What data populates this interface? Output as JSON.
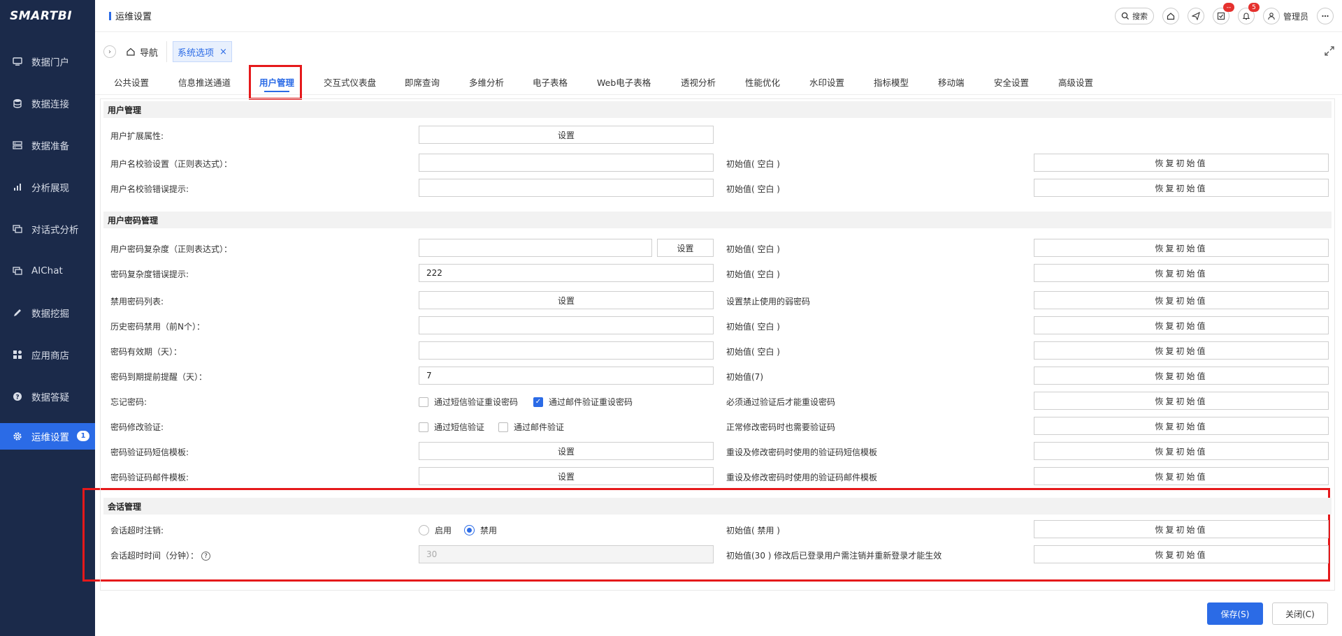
{
  "app": {
    "logo": "SMARTBI"
  },
  "sidebar": {
    "items": [
      {
        "label": "数据门户",
        "icon": "monitor-icon"
      },
      {
        "label": "数据连接",
        "icon": "database-icon"
      },
      {
        "label": "数据准备",
        "icon": "server-icon"
      },
      {
        "label": "分析展现",
        "icon": "bar-chart-icon"
      },
      {
        "label": "对话式分析",
        "icon": "chat-icon"
      },
      {
        "label": "AIChat",
        "icon": "chat-icon"
      },
      {
        "label": "数据挖掘",
        "icon": "pen-icon"
      },
      {
        "label": "应用商店",
        "icon": "apps-icon"
      },
      {
        "label": "数据答疑",
        "icon": "question-icon"
      },
      {
        "label": "运维设置",
        "icon": "gear-icon",
        "badge": "1"
      }
    ]
  },
  "header": {
    "title": "运维设置",
    "search_label": "搜索",
    "task_badge": "--",
    "notice_badge": "5",
    "user": "管理员"
  },
  "breadcrumb": {
    "home": "导航",
    "tab": "系统选项"
  },
  "tabs": [
    "公共设置",
    "信息推送通道",
    "用户管理",
    "交互式仪表盘",
    "即席查询",
    "多维分析",
    "电子表格",
    "Web电子表格",
    "透视分析",
    "性能优化",
    "水印设置",
    "指标模型",
    "移动端",
    "安全设置",
    "高级设置"
  ],
  "active_tab": "用户管理",
  "sections": {
    "user_mgmt": "用户管理",
    "pwd_mgmt": "用户密码管理",
    "session_mgmt": "会话管理"
  },
  "common": {
    "set": "设置",
    "restore": "恢复初始值",
    "init_blank": "初始值( 空白 )"
  },
  "rows": {
    "ext_attr": {
      "label": "用户扩展属性:"
    },
    "name_check": {
      "label": "用户名校验设置（正则表达式）：",
      "value": ""
    },
    "name_err": {
      "label": "用户名校验错误提示:",
      "value": ""
    },
    "pwd_complex": {
      "label": "用户密码复杂度（正则表达式）：",
      "value": ""
    },
    "pwd_complex_err": {
      "label": "密码复杂度错误提示:",
      "value": "222"
    },
    "banned_list": {
      "label": "禁用密码列表:",
      "hint": "设置禁止使用的弱密码"
    },
    "history": {
      "label": "历史密码禁用（前N个）：",
      "value": ""
    },
    "validity": {
      "label": "密码有效期（天）：",
      "value": ""
    },
    "remind": {
      "label": "密码到期提前提醒（天）：",
      "value": "7",
      "hint": "初始值(7)"
    },
    "forgot": {
      "label": "忘记密码:",
      "opt1": "通过短信验证重设密码",
      "opt2": "通过邮件验证重设密码",
      "hint": "必须通过验证后才能重设密码"
    },
    "modify_verify": {
      "label": "密码修改验证:",
      "opt1": "通过短信验证",
      "opt2": "通过邮件验证",
      "hint": "正常修改密码时也需要验证码"
    },
    "sms_tpl": {
      "label": "密码验证码短信模板:",
      "hint": "重设及修改密码时使用的验证码短信模板"
    },
    "mail_tpl": {
      "label": "密码验证码邮件模板:",
      "hint": "重设及修改密码时使用的验证码邮件模板"
    },
    "session_logout": {
      "label": "会话超时注销:",
      "opt_on": "启用",
      "opt_off": "禁用",
      "hint": "初始值( 禁用 )"
    },
    "session_timeout": {
      "label": "会话超时时间（分钟）：",
      "value": "30",
      "hint": "初始值(30 ) 修改后已登录用户需注销并重新登录才能生效"
    }
  },
  "footer": {
    "save": "保存(S)",
    "close": "关闭(C)"
  },
  "colors": {
    "accent": "#2b6be6",
    "sidebar": "#1b2a4a",
    "highlight": "#e5191b"
  }
}
